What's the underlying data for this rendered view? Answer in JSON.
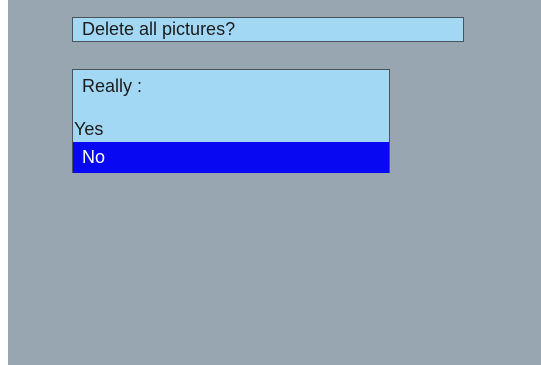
{
  "dialog": {
    "title": "Delete all pictures?",
    "prompt": "Really :",
    "options": [
      {
        "label": "Yes",
        "selected": false
      },
      {
        "label": "No",
        "selected": true
      }
    ]
  },
  "colors": {
    "background": "#97a6b1",
    "panel": "#a3d8f5",
    "highlight": "#0808f2",
    "border": "#4c5358"
  }
}
